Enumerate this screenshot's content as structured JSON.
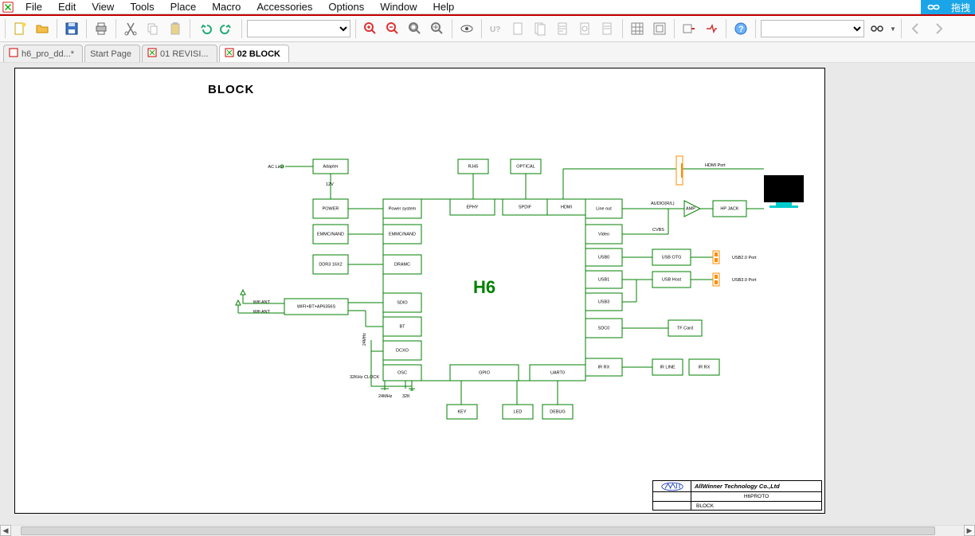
{
  "menu": {
    "items": [
      "File",
      "Edit",
      "View",
      "Tools",
      "Place",
      "Macro",
      "Accessories",
      "Options",
      "Window",
      "Help"
    ]
  },
  "screenshot_tag": "拖拽",
  "toolbar_dropdown1_value": "",
  "toolbar_dropdown2_value": "",
  "tabs": [
    {
      "label": "h6_pro_dd...*",
      "kind": "design",
      "active": false
    },
    {
      "label": "Start Page",
      "kind": "start",
      "active": false
    },
    {
      "label": "01 REVISI...",
      "kind": "sheet",
      "active": false
    },
    {
      "label": "02 BLOCK",
      "kind": "sheet",
      "active": true
    }
  ],
  "sheet": {
    "title": "BLOCK",
    "chip": "H6",
    "company": "AllWinner Technology Co.,Ltd",
    "product": "H6PROTO",
    "sheet_name": "BLOCK",
    "labels": {
      "ac_line": "AC Line",
      "adapter": "Adapter",
      "v12": "12V",
      "power": "POWER",
      "emmc_nand_l": "EMMC/NAND",
      "ddr3": "DDR3 16X2",
      "wifi_ant": "Wifi ANT",
      "wifi_ant2": "Wifi ANT",
      "wifi_bt": "WIFI+BT+AP6356S",
      "clock32k": "32KHz CLOCK",
      "osc24": "24MHz",
      "osc32k": "32K",
      "rj45": "RJ45",
      "optical": "OPTICAL",
      "power_system": "Power system",
      "ephy": "EPHY",
      "spdif": "SPDIF",
      "hdmi": "HDMI",
      "emmc_nand": "EMMC/NAND",
      "dramc": "DRAMC",
      "sdio": "SDIO",
      "bt": "BT",
      "dcxo": "DCXO",
      "osc": "OSC",
      "gpio": "GPIO",
      "uart0": "UART0",
      "line_out": "Line out",
      "video": "Video",
      "usb0": "USB0",
      "usb1": "USB1",
      "usb3": "USB3",
      "sdc0": "SDC0",
      "ir_rx_port": "IR RX",
      "audio": "AUDIO(R/L)",
      "amp": "AMP",
      "hp_jack": "HP JACK",
      "cvbs": "CVBS",
      "usb_otg": "USB OTG",
      "usb_host": "USB Host",
      "usb20": "USB2.0 Port",
      "usb30": "USB3.0 Port",
      "tf_card": "TF Card",
      "ir_line": "IR LINE",
      "ir_rx": "IR RX",
      "key": "KEY",
      "led": "LED",
      "debug": "DEBUG",
      "hdmi_port": "HDMI Port",
      "q24mhz": "24MHz"
    }
  }
}
